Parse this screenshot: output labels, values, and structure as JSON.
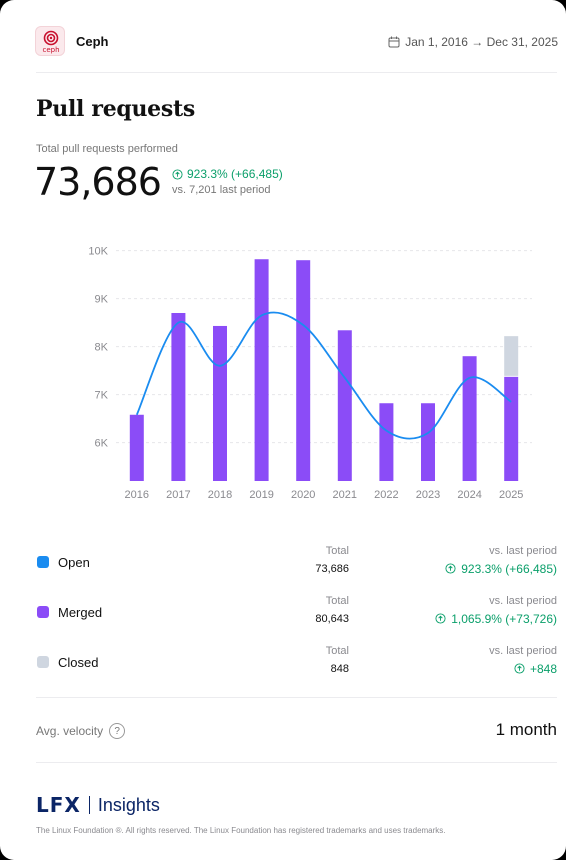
{
  "header": {
    "logo_text": "ceph",
    "project_name": "Ceph",
    "date_range": "Jan 1, 2016 → Dec 31, 2025"
  },
  "title": "Pull requests",
  "summary": {
    "label": "Total pull requests performed",
    "value": "73,686",
    "delta": "923.3% (+66,485)",
    "comparison": "vs. 7,201 last period"
  },
  "chart_data": {
    "type": "bar",
    "categories": [
      "2016",
      "2017",
      "2018",
      "2019",
      "2020",
      "2021",
      "2022",
      "2023",
      "2024",
      "2025"
    ],
    "y_ticks": [
      "6K",
      "7K",
      "8K",
      "9K",
      "10K"
    ],
    "ylim": [
      5200,
      10200
    ],
    "grid": true,
    "series": [
      {
        "name": "Merged",
        "kind": "bar",
        "color": "#8b4cf7",
        "values": [
          6580,
          8700,
          8430,
          9820,
          9800,
          8340,
          6820,
          6820,
          7800,
          7370
        ]
      },
      {
        "name": "Closed",
        "kind": "bar-stacked",
        "color": "#cfd6e0",
        "values": [
          0,
          0,
          0,
          0,
          0,
          0,
          0,
          0,
          0,
          848
        ]
      },
      {
        "name": "Open",
        "kind": "line",
        "color": "#1a8cf0",
        "values": [
          6580,
          8500,
          7600,
          8650,
          8450,
          7350,
          6250,
          6200,
          7350,
          6850
        ]
      }
    ]
  },
  "legend_rows": [
    {
      "name": "Open",
      "color": "#1a8cf0",
      "total_label": "Total",
      "total": "73,686",
      "vs_label": "vs. last period",
      "vs": "923.3% (+66,485)"
    },
    {
      "name": "Merged",
      "color": "#8b4cf7",
      "total_label": "Total",
      "total": "80,643",
      "vs_label": "vs. last period",
      "vs": "1,065.9% (+73,726)"
    },
    {
      "name": "Closed",
      "color": "#cfd6e0",
      "total_label": "Total",
      "total": "848",
      "vs_label": "vs. last period",
      "vs": "+848"
    }
  ],
  "velocity": {
    "label": "Avg. velocity",
    "help": "?",
    "value": "1 month"
  },
  "footer": {
    "brand_mark": "LFX",
    "brand_product": "Insights",
    "text": "The Linux Foundation ®. All rights reserved. The Linux Foundation has registered trademarks and uses trademarks."
  }
}
